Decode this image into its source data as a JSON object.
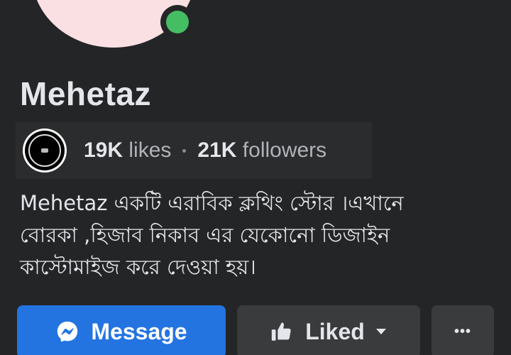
{
  "profile": {
    "name": "Mehetaz",
    "online_color": "#45bd62"
  },
  "stats": {
    "likes_count": "19K",
    "likes_label": "likes",
    "followers_count": "21K",
    "followers_label": "followers"
  },
  "bio": {
    "lines": [
      "Mehetaz একটি এরাবিক ক্লথিং স্টোর ।এখানে",
      "বোরকা ,হিজাব নিকাব এর যেকোনো ডিজাইন",
      "কাস্টোমাইজ করে দেওয়া হয়।"
    ]
  },
  "actions": {
    "message_label": "Message",
    "liked_label": "Liked",
    "more_label": "•••",
    "message_color": "#2374e1"
  },
  "icons": {
    "message": "messenger-icon",
    "liked": "thumbs-up-icon",
    "dropdown": "caret-down-icon",
    "more": "more-dots-icon"
  }
}
